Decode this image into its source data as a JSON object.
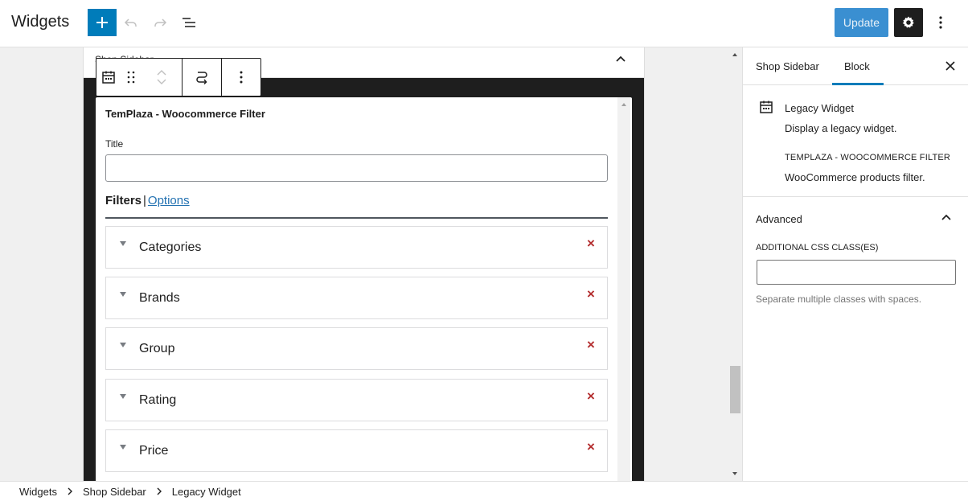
{
  "header": {
    "title": "Widgets",
    "update_label": "Update",
    "icons": {
      "add": "plus-icon",
      "undo": "undo-icon",
      "redo": "redo-icon",
      "list_view": "list-view-icon",
      "settings": "gear-icon",
      "options": "more-vertical-icon"
    }
  },
  "widget_area": {
    "title": "Shop Sidebar"
  },
  "widget": {
    "name": "TemPlaza - Woocommerce Filter",
    "title_label": "Title",
    "title_value": "",
    "tabs": {
      "filters": "Filters",
      "separator": "|",
      "options": "Options"
    },
    "filters": [
      {
        "label": "Categories",
        "remove": "×"
      },
      {
        "label": "Brands",
        "remove": "×"
      },
      {
        "label": "Group",
        "remove": "×"
      },
      {
        "label": "Rating",
        "remove": "×"
      },
      {
        "label": "Price",
        "remove": "×"
      }
    ]
  },
  "sidebar": {
    "tabs": {
      "area": "Shop Sidebar",
      "block": "Block"
    },
    "active_tab": "Block",
    "block_card": {
      "title": "Legacy Widget",
      "description": "Display a legacy widget.",
      "variation_title": "TEMPLAZA - WOOCOMMERCE FILTER",
      "variation_description": "WooCommerce products filter."
    },
    "advanced": {
      "title": "Advanced",
      "css_label": "ADDITIONAL CSS CLASS(ES)",
      "css_value": "",
      "css_help": "Separate multiple classes with spaces."
    }
  },
  "breadcrumb": {
    "items": [
      "Widgets",
      "Shop Sidebar",
      "Legacy Widget"
    ]
  },
  "colors": {
    "accent": "#007cba",
    "update_button": "#3a8fd1",
    "remove": "#b32d2e",
    "link": "#2271b1"
  }
}
